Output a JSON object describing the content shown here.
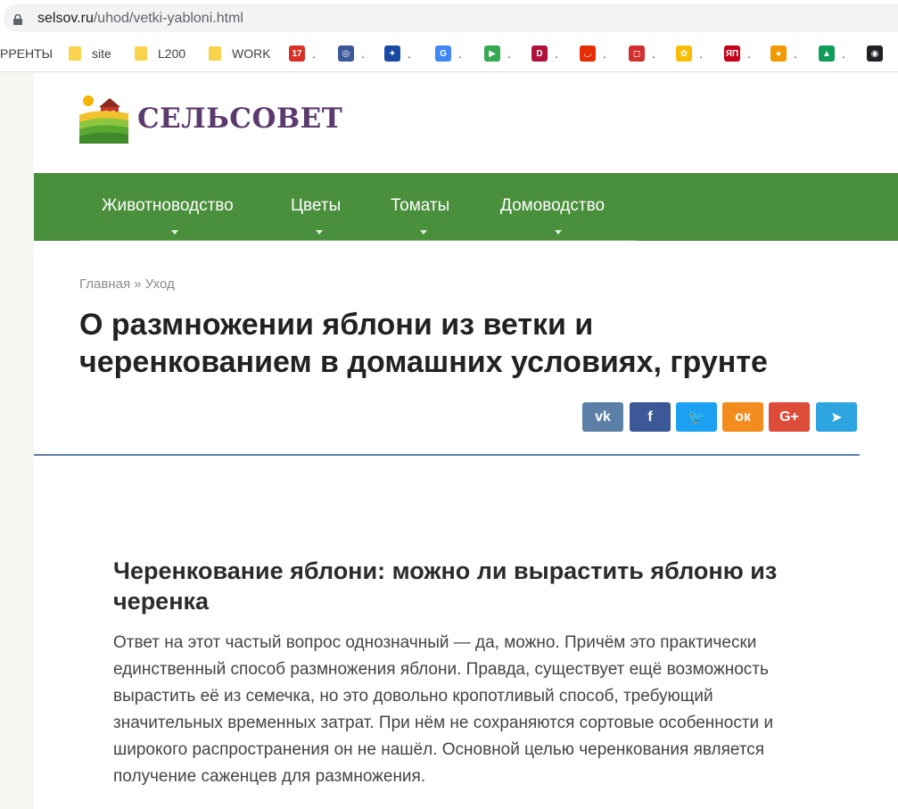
{
  "browser": {
    "url_domain": "selsov.ru",
    "url_path": "/uhod/vetki-yabloni.html",
    "bookmarks": [
      {
        "label": "РРЕНТЫ",
        "type": "text"
      },
      {
        "label": "site",
        "type": "folder"
      },
      {
        "label": "L200",
        "type": "folder"
      },
      {
        "label": "WORK",
        "type": "folder"
      },
      {
        "label": ".",
        "type": "favicon",
        "icon": "calendar-icon",
        "text": "17",
        "color": "#d93025"
      },
      {
        "label": ".",
        "type": "favicon",
        "icon": "emblem-icon",
        "text": "◎",
        "color": "#3b5998"
      },
      {
        "label": ".",
        "type": "favicon",
        "icon": "eagle-icon",
        "text": "✦",
        "color": "#1a4aa3"
      },
      {
        "label": ".",
        "type": "favicon",
        "icon": "translate-icon",
        "text": "G",
        "color": "#4285f4"
      },
      {
        "label": ".",
        "type": "favicon",
        "icon": "play-store-icon",
        "text": "▶",
        "color": "#34a853"
      },
      {
        "label": ".",
        "type": "favicon",
        "icon": "d-logo-icon",
        "text": "D",
        "color": "#b0123a"
      },
      {
        "label": ".",
        "type": "favicon",
        "icon": "shop-bag-icon",
        "text": "◡",
        "color": "#e62e04"
      },
      {
        "label": ".",
        "type": "favicon",
        "icon": "chat-bubble-icon",
        "text": "◻",
        "color": "#d32f2f"
      },
      {
        "label": ".",
        "type": "favicon",
        "icon": "pinwheel-icon",
        "text": "✿",
        "color": "#fbbc05"
      },
      {
        "label": ".",
        "type": "favicon",
        "icon": "yp-logo-icon",
        "text": "ЯП",
        "color": "#c4001a"
      },
      {
        "label": ".",
        "type": "favicon",
        "icon": "orange-icon",
        "text": "●",
        "color": "#f29900"
      },
      {
        "label": ".",
        "type": "favicon",
        "icon": "drive-icon",
        "text": "▲",
        "color": "#0f9d58"
      },
      {
        "label": "",
        "type": "favicon",
        "icon": "gauge-icon",
        "text": "◉",
        "color": "#202124"
      }
    ]
  },
  "site": {
    "brand": "СЕЛЬСОВЕТ",
    "nav": [
      "Животноводство",
      "Цветы",
      "Томаты",
      "Домоводство"
    ],
    "breadcrumb": {
      "home": "Главная",
      "sep": " » ",
      "current": "Уход"
    },
    "title_lines": [
      "О размножении яблони из ветки и",
      "черенкованием в домашних условиях, грунте"
    ],
    "share": [
      {
        "icon": "vk-icon",
        "text": "vk",
        "color": "#5b7fa6"
      },
      {
        "icon": "facebook-icon",
        "text": "f",
        "color": "#3b5998"
      },
      {
        "icon": "twitter-icon",
        "text": "🐦",
        "color": "#1da1f2"
      },
      {
        "icon": "odnoklassniki-icon",
        "text": "ок",
        "color": "#f28c1e"
      },
      {
        "icon": "google-plus-icon",
        "text": "G+",
        "color": "#dd4b39"
      },
      {
        "icon": "telegram-icon",
        "text": "➤",
        "color": "#2ca5e0"
      }
    ],
    "section_heading_lines": [
      "Черенкование яблони: можно ли вырастить яблоню из",
      "черенка"
    ],
    "paragraph_lines": [
      "Ответ на этот частый вопрос однозначный — да, можно. Причём это практически",
      "единственный способ размножения яблони. Правда, существует ещё возможность",
      "вырастить её из семечка, но это довольно кропотливый способ, требующий",
      "значительных временных затрат. При нём не сохраняются сортовые особенности и",
      "широкого распространения он не нашёл. Основной целью черенкования является",
      "получение саженцев для размножения."
    ]
  }
}
